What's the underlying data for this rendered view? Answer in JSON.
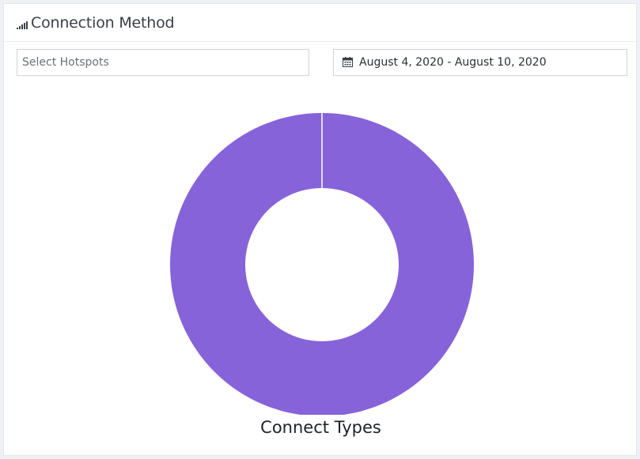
{
  "panel": {
    "title": "Connection Method",
    "title_icon": "signal-bars-icon"
  },
  "filters": {
    "hotspot_placeholder": "Select Hotspots",
    "date_icon": "calendar-icon",
    "date_range": "August 4, 2020 - August 10, 2020"
  },
  "colors": {
    "slice": "#8763d9",
    "background": "#ffffff"
  },
  "chart_data": {
    "type": "pie",
    "style": "donut",
    "title": "Connect Types",
    "slices": [
      {
        "label": "",
        "value": 1
      }
    ],
    "legend": "none"
  }
}
